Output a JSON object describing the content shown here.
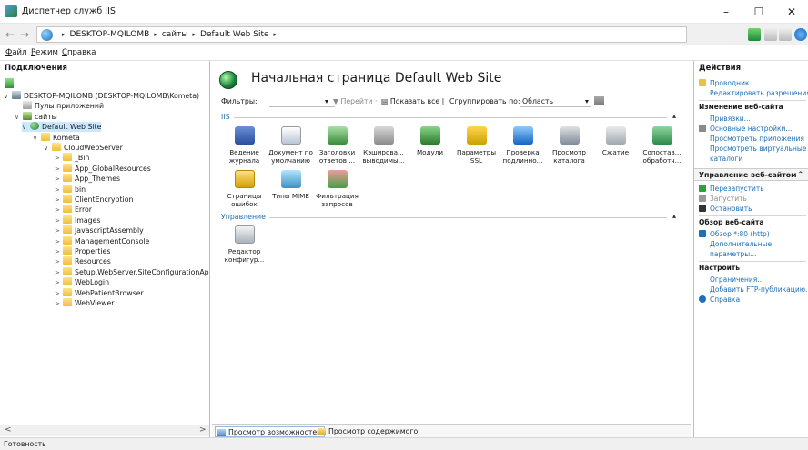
{
  "window": {
    "title": "Диспетчер служб IIS",
    "controls": {
      "minimize": "–",
      "maximize": "☐",
      "close": "✕"
    }
  },
  "address": {
    "crumbs": [
      "DESKTOP-MQILOMB",
      "сайты",
      "Default Web Site"
    ],
    "sep": "▸",
    "back": "←",
    "forward": "→"
  },
  "menu": [
    {
      "key": "Ф",
      "rest": "айл"
    },
    {
      "key": "Р",
      "rest": "ежим"
    },
    {
      "key": "С",
      "rest": "правка"
    }
  ],
  "connections": {
    "header": "Подключения",
    "scroll_left": "<",
    "scroll_right": ">",
    "tree": [
      {
        "label": "DESKTOP-MQILOMB (DESKTOP-MQILOMB\\Kometa)",
        "chev": "∨",
        "icon": "server"
      },
      {
        "label": "Пулы приложений",
        "chev": "",
        "icon": "pool"
      },
      {
        "label": "сайты",
        "chev": "∨",
        "icon": "sites"
      },
      {
        "label": "Default Web Site",
        "chev": "∨",
        "icon": "site"
      },
      {
        "label": "Kometa",
        "chev": "∨",
        "icon": "folder"
      },
      {
        "label": "CloudWebServer",
        "chev": "∨",
        "icon": "folder"
      },
      {
        "label": "_Bin",
        "chev": ">",
        "icon": "folder"
      },
      {
        "label": "App_GlobalResources",
        "chev": ">",
        "icon": "folder"
      },
      {
        "label": "App_Themes",
        "chev": ">",
        "icon": "folder"
      },
      {
        "label": "bin",
        "chev": ">",
        "icon": "folder"
      },
      {
        "label": "ClientEncryption",
        "chev": ">",
        "icon": "folder"
      },
      {
        "label": "Error",
        "chev": ">",
        "icon": "folder"
      },
      {
        "label": "Images",
        "chev": ">",
        "icon": "folder"
      },
      {
        "label": "JavascriptAssembly",
        "chev": ">",
        "icon": "folder"
      },
      {
        "label": "ManagementConsole",
        "chev": ">",
        "icon": "folder"
      },
      {
        "label": "Properties",
        "chev": ">",
        "icon": "folder"
      },
      {
        "label": "Resources",
        "chev": ">",
        "icon": "folder"
      },
      {
        "label": "Setup.WebServer.SiteConfigurationAp",
        "chev": ">",
        "icon": "folder"
      },
      {
        "label": "WebLogin",
        "chev": ">",
        "icon": "folder"
      },
      {
        "label": "WebPatientBrowser",
        "chev": ">",
        "icon": "folder"
      },
      {
        "label": "WebViewer",
        "chev": ">",
        "icon": "folder"
      }
    ]
  },
  "center": {
    "title": "Начальная страница Default Web Site",
    "filter": {
      "label": "Фильтры:",
      "go": "Перейти",
      "show_all": "Показать все",
      "group_by": "Сгруппировать по:",
      "group_value": "Область",
      "dropdown_glyph": "▾"
    },
    "sections": [
      {
        "name": "IIS",
        "collapse": "▴"
      },
      {
        "name": "Управление",
        "collapse": "▴"
      }
    ],
    "iis_features": [
      {
        "label": "Ведение журнала",
        "icon": "log"
      },
      {
        "label": "Документ по умолчанию",
        "icon": "doc"
      },
      {
        "label": "Заголовки ответов ...",
        "icon": "hdr"
      },
      {
        "label": "Кэширова... выводимы...",
        "icon": "cache"
      },
      {
        "label": "Модули",
        "icon": "mod"
      },
      {
        "label": "Параметры SSL",
        "icon": "ssl"
      },
      {
        "label": "Проверка подлинно...",
        "icon": "auth"
      },
      {
        "label": "Просмотр каталога",
        "icon": "dir"
      },
      {
        "label": "Сжатие",
        "icon": "zip"
      },
      {
        "label": "Сопостав... обработч...",
        "icon": "map"
      },
      {
        "label": "Страницы ошибок",
        "icon": "err"
      },
      {
        "label": "Типы MIME",
        "icon": "mime"
      },
      {
        "label": "Фильтрация запросов",
        "icon": "filter"
      }
    ],
    "mgmt_features": [
      {
        "label": "Редактор конфигур...",
        "icon": "cfg"
      }
    ],
    "tabs": [
      "Просмотр возможностей",
      "Просмотр содержимого"
    ]
  },
  "actions": {
    "header": "Действия",
    "items": [
      {
        "text": "Проводник",
        "style": "link"
      },
      {
        "text": "Редактировать разрешения...",
        "style": "link"
      },
      {
        "text": "Изменение веб-сайта",
        "style": "head"
      },
      {
        "text": "Привязки...",
        "style": "link"
      },
      {
        "text": "Основные настройки...",
        "style": "link"
      },
      {
        "text": "Просмотреть приложения",
        "style": "link"
      },
      {
        "text": "Просмотреть виртуальные",
        "style": "link"
      },
      {
        "text": "каталоги",
        "style": "link"
      },
      {
        "text": "Управление веб-сайтом",
        "style": "group"
      },
      {
        "text": "Перезапустить",
        "style": "link"
      },
      {
        "text": "Запустить",
        "style": "gray"
      },
      {
        "text": "Остановить",
        "style": "link"
      },
      {
        "text": "Обзор веб-сайта",
        "style": "head"
      },
      {
        "text": "Обзор *:80 (http)",
        "style": "link"
      },
      {
        "text": "Дополнительные",
        "style": "link"
      },
      {
        "text": "параметры...",
        "style": "link"
      },
      {
        "text": "Настроить",
        "style": "head"
      },
      {
        "text": "Ограничения...",
        "style": "link"
      },
      {
        "text": "Добавить FTP-публикацию...",
        "style": "link"
      },
      {
        "text": "Справка",
        "style": "link"
      }
    ],
    "group_collapse": "⌃"
  },
  "status": {
    "text": "Готовность"
  },
  "colors": {
    "accent": "#1e6fb6",
    "selection": "#cce8ff"
  }
}
